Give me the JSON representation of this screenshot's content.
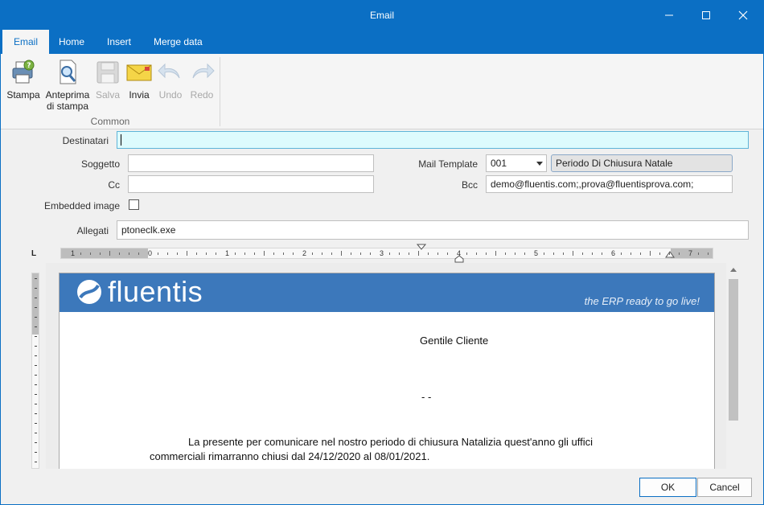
{
  "window": {
    "title": "Email"
  },
  "tabs": [
    {
      "label": "Email",
      "active": true
    },
    {
      "label": "Home"
    },
    {
      "label": "Insert"
    },
    {
      "label": "Merge data"
    }
  ],
  "ribbon": {
    "buttons": {
      "stampa": "Stampa",
      "anteprima_line1": "Anteprima",
      "anteprima_line2": "di stampa",
      "salva": "Salva",
      "invia": "Invia",
      "undo": "Undo",
      "redo": "Redo"
    },
    "group_label": "Common"
  },
  "form": {
    "destinatari_label": "Destinatari",
    "destinatari_value": "",
    "soggetto_label": "Soggetto",
    "soggetto_value": "",
    "cc_label": "Cc",
    "cc_value": "",
    "mail_template_label": "Mail Template",
    "mail_template_code": "001",
    "mail_template_name": "Periodo Di Chiusura Natale",
    "bcc_label": "Bcc",
    "bcc_value": "demo@fluentis.com;,prova@fluentisprova.com;",
    "embedded_image_label": "Embedded image",
    "embedded_image_checked": false,
    "allegati_label": "Allegati",
    "allegati_value": "ptoneclk.exe"
  },
  "ruler": {
    "corner": "L",
    "numbers": [
      "1",
      "0",
      "1",
      "2",
      "3",
      "4",
      "5",
      "6",
      "7"
    ]
  },
  "document": {
    "logo_text": "fluentis",
    "tagline": "the ERP ready to go live!",
    "greeting": "Gentile Cliente",
    "dashes": "- -",
    "body_line1": "La presente per comunicare nel nostro periodo di chiusura Natalizia quest'anno gli uffici",
    "body_line2": "commerciali rimarranno chiusi dal 24/12/2020 al 08/01/2021."
  },
  "footer": {
    "ok": "OK",
    "cancel": "Cancel"
  },
  "colors": {
    "accent": "#0b6fc4",
    "banner": "#3c78bb",
    "focused_field": "#ddfbfd"
  }
}
